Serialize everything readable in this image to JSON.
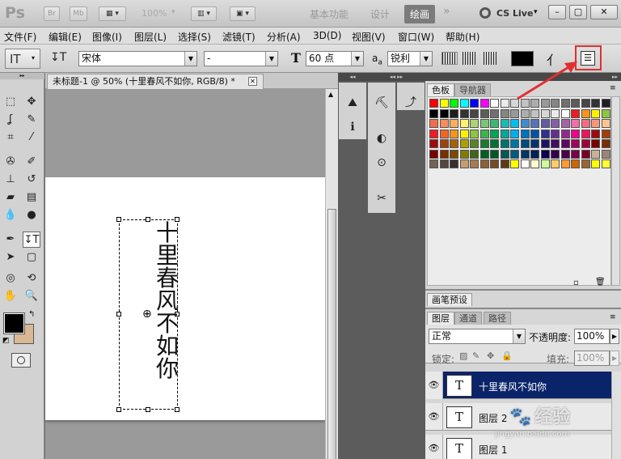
{
  "app": {
    "logo": "Ps",
    "bridge_label": "Br",
    "minibridge_label": "Mb",
    "zoom_level": "100%",
    "workspaces": [
      "基本功能",
      "设计",
      "绘画"
    ],
    "active_workspace": "绘画",
    "more_label": "»",
    "cslive_label": "CS Live"
  },
  "menu": [
    "文件(F)",
    "编辑(E)",
    "图像(I)",
    "图层(L)",
    "选择(S)",
    "滤镜(T)",
    "分析(A)",
    "3D(D)",
    "视图(V)",
    "窗口(W)",
    "帮助(H)"
  ],
  "options": {
    "tool_label": "IT",
    "font_family": "宋体",
    "font_style": "-",
    "font_size": "60 点",
    "aa_label": "a",
    "aa_method": "锐利",
    "text_color": "#000000"
  },
  "document": {
    "tab_title": "未标题-1 @ 50% (十里春风不如你, RGB/8) *",
    "text_chars": [
      "十",
      "里",
      "春",
      "风",
      "不",
      "如",
      "你"
    ]
  },
  "tools": {
    "foreground": "#000000",
    "background": "#d9b894"
  },
  "swatches_panel": {
    "tabs": [
      "色板",
      "导航器"
    ]
  },
  "brush_panel": {
    "title": "画笔预设"
  },
  "layers_panel": {
    "tabs": [
      "图层",
      "通道",
      "路径"
    ],
    "blend_mode": "正常",
    "opacity_label": "不透明度:",
    "opacity": "100%",
    "lock_label": "锁定:",
    "fill_label": "填充:",
    "fill": "100%",
    "layers": [
      {
        "name": "十里春风不如你",
        "thumb": "T",
        "selected": true
      },
      {
        "name": "图层 2",
        "thumb": "T",
        "selected": false
      },
      {
        "name": "图层 1",
        "thumb": "T",
        "selected": false
      }
    ]
  },
  "watermark": {
    "text": "经验",
    "subtext": "jingyan.baidu.com"
  },
  "colors": {
    "highlight": "#e03030",
    "layer_selected": "#0a246a"
  }
}
